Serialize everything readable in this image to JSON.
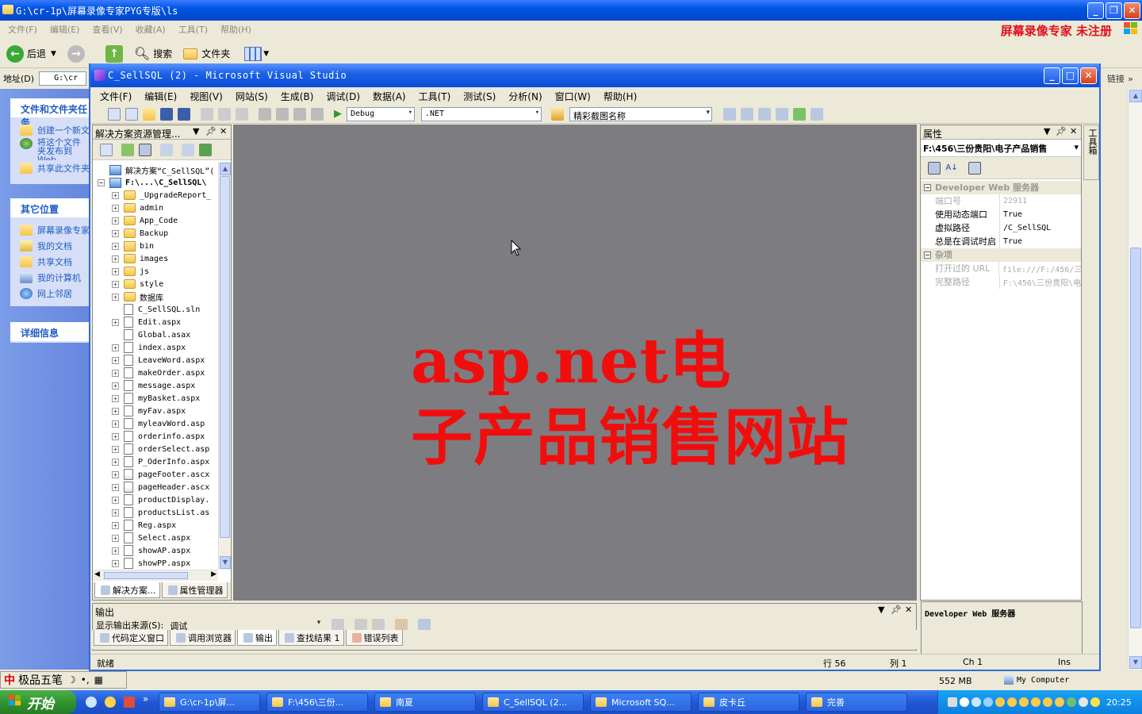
{
  "outer_window": {
    "title": "G:\\cr-1p\\屏幕录像专家PYG专版\\ls",
    "menu": [
      "文件(F)",
      "编辑(E)",
      "查看(V)",
      "收藏(A)",
      "工具(T)",
      "帮助(H)"
    ],
    "brand_text": "屏幕录像专家 未注册",
    "toolbar": {
      "back": "后退",
      "search": "搜索",
      "folders": "文件夹"
    },
    "address_label": "地址(D)",
    "address_value": "G:\\cr",
    "links_label": "链接"
  },
  "task_pane": {
    "groups": [
      {
        "title": "文件和文件夹任务",
        "items": [
          "创建一个新文件夹",
          "将这个文件夹发布到 Web",
          "共享此文件夹"
        ]
      },
      {
        "title": "其它位置",
        "items": [
          "屏幕录像专家",
          "我的文档",
          "共享文档",
          "我的计算机",
          "网上邻居"
        ]
      },
      {
        "title": "详细信息",
        "items": []
      }
    ]
  },
  "vs": {
    "title": "C_SellSQL (2) - Microsoft Visual Studio",
    "menu": [
      "文件(F)",
      "编辑(E)",
      "视图(V)",
      "网站(S)",
      "生成(B)",
      "调试(D)",
      "数据(A)",
      "工具(T)",
      "测试(S)",
      "分析(N)",
      "窗口(W)",
      "帮助(H)"
    ],
    "config_combo": "Debug",
    "platform_combo": ".NET",
    "find_combo": "精彩截图名称",
    "solution_explorer": {
      "title": "解决方案资源管理...",
      "solution": "解决方案“C_SellSQL”(",
      "project": "F:\\...\\C_SellSQL\\",
      "items": [
        {
          "name": "_UpgradeReport_",
          "type": "folder"
        },
        {
          "name": "admin",
          "type": "folder"
        },
        {
          "name": "App_Code",
          "type": "folder"
        },
        {
          "name": "Backup",
          "type": "folder"
        },
        {
          "name": "bin",
          "type": "bin"
        },
        {
          "name": "images",
          "type": "folder"
        },
        {
          "name": "js",
          "type": "folder"
        },
        {
          "name": "style",
          "type": "folder"
        },
        {
          "name": "数据库",
          "type": "folder"
        },
        {
          "name": "C_SellSQL.sln",
          "type": "file"
        },
        {
          "name": "Edit.aspx",
          "type": "file"
        },
        {
          "name": "Global.asax",
          "type": "file"
        },
        {
          "name": "index.aspx",
          "type": "file"
        },
        {
          "name": "LeaveWord.aspx",
          "type": "file"
        },
        {
          "name": "makeOrder.aspx",
          "type": "file"
        },
        {
          "name": "message.aspx",
          "type": "file"
        },
        {
          "name": "myBasket.aspx",
          "type": "file"
        },
        {
          "name": "myFav.aspx",
          "type": "file"
        },
        {
          "name": "myleavWord.asp",
          "type": "file"
        },
        {
          "name": "orderinfo.aspx",
          "type": "file"
        },
        {
          "name": "orderSelect.asp",
          "type": "file"
        },
        {
          "name": "P_OderInfo.aspx",
          "type": "file"
        },
        {
          "name": "pageFooter.ascx",
          "type": "gfile"
        },
        {
          "name": "pageHeader.ascx",
          "type": "gfile"
        },
        {
          "name": "productDisplay.",
          "type": "file"
        },
        {
          "name": "productsList.as",
          "type": "file"
        },
        {
          "name": "Reg.aspx",
          "type": "file"
        },
        {
          "name": "Select.aspx",
          "type": "file"
        },
        {
          "name": "showAP.aspx",
          "type": "file"
        },
        {
          "name": "showPP.aspx",
          "type": "file"
        }
      ],
      "tabs": [
        "解决方案...",
        "属性管理器"
      ]
    },
    "watermark": {
      "line1": "asp.net电",
      "line2": "子产品销售网站"
    },
    "properties": {
      "title": "属性",
      "object": "F:\\456\\三份贵阳\\电子产品销售",
      "category1": "Developer Web 服务器",
      "rows1": [
        {
          "key": "端口号",
          "value": "22911",
          "dim": true
        },
        {
          "key": "使用动态端口",
          "value": "True",
          "dim": false
        },
        {
          "key": "虚拟路径",
          "value": "/C_SellSQL",
          "dim": false
        },
        {
          "key": "总是在调试时启",
          "value": "True",
          "dim": false
        }
      ],
      "category2": "杂项",
      "rows2": [
        {
          "key": "打开过的 URL",
          "value": "file:///F:/456/三",
          "dim": true
        },
        {
          "key": "完整路径",
          "value": "F:\\456\\三份贵阳\\电",
          "dim": true
        }
      ],
      "description": "Developer Web 服务器"
    },
    "toolbox_label": "工具箱",
    "output": {
      "title": "输出",
      "source_label": "显示输出来源(S):",
      "source_value": "调试",
      "tabs": [
        "代码定义窗口",
        "调用浏览器",
        "输出",
        "查找结果 1",
        "错误列表"
      ]
    },
    "status": {
      "ready": "就绪",
      "line": "行 56",
      "col": "列 1",
      "ch": "Ch 1",
      "ins": "Ins"
    }
  },
  "language_bar": {
    "ime": "极品五笔"
  },
  "outer_status": {
    "size": "552 MB",
    "location": "My Computer"
  },
  "taskbar": {
    "start": "开始",
    "tasks": [
      "G:\\cr-1p\\屏...",
      "F:\\456\\三份...",
      "南夏",
      "C_SellSQL (2...",
      "Microsoft SQ...",
      "皮卡丘",
      "完善"
    ],
    "clock": "20:25"
  }
}
